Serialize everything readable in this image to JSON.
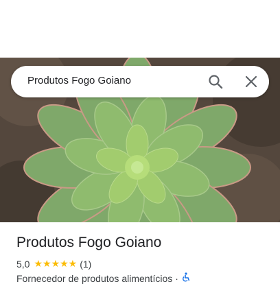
{
  "search": {
    "query": "Produtos Fogo Goiano"
  },
  "icons": {
    "search": "search-icon",
    "close": "close-icon",
    "wheelchair": "wheelchair-accessible-icon"
  },
  "place": {
    "name": "Produtos Fogo Goiano",
    "rating": "5,0",
    "stars": "★★★★★",
    "rating_value": 5,
    "review_count": "(1)",
    "category": "Fornecedor de produtos alimentícios",
    "separator": "·"
  },
  "colors": {
    "star": "#fbbc04",
    "accessible_icon": "#1a73e8",
    "text_primary": "#202124"
  }
}
